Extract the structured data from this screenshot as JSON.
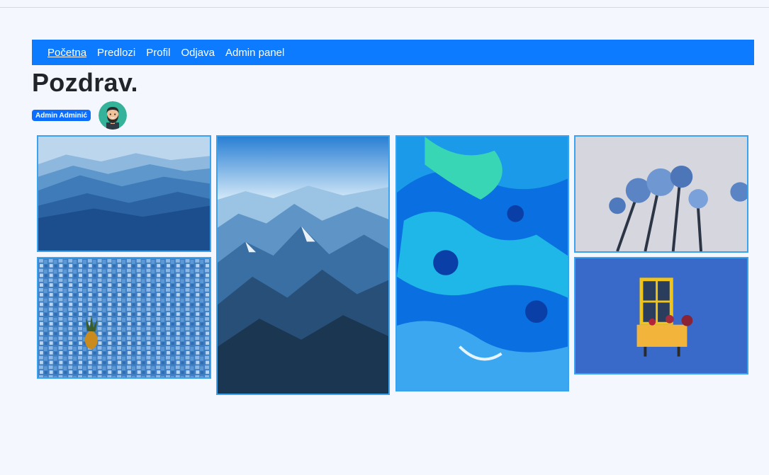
{
  "nav": {
    "items": [
      "Početna",
      "Predlozi",
      "Profil",
      "Odjava",
      "Admin panel"
    ]
  },
  "greeting": "Pozdrav.",
  "user": {
    "name": "Admin Adminić"
  },
  "gallery": {
    "images": [
      {
        "subject": "misty blue mountain ridges"
      },
      {
        "subject": "pineapple in blue mosaic pool"
      },
      {
        "subject": "aerial view of snowy mountains"
      },
      {
        "subject": "blue and green fluid abstract"
      },
      {
        "subject": "blue flowers against white wall"
      },
      {
        "subject": "yellow window with flower box on blue wall"
      }
    ]
  },
  "colors": {
    "nav": "#0d7bff",
    "badge": "#0d6efd",
    "tile_border": "#3aa2ef",
    "background": "#f4f7fd"
  }
}
